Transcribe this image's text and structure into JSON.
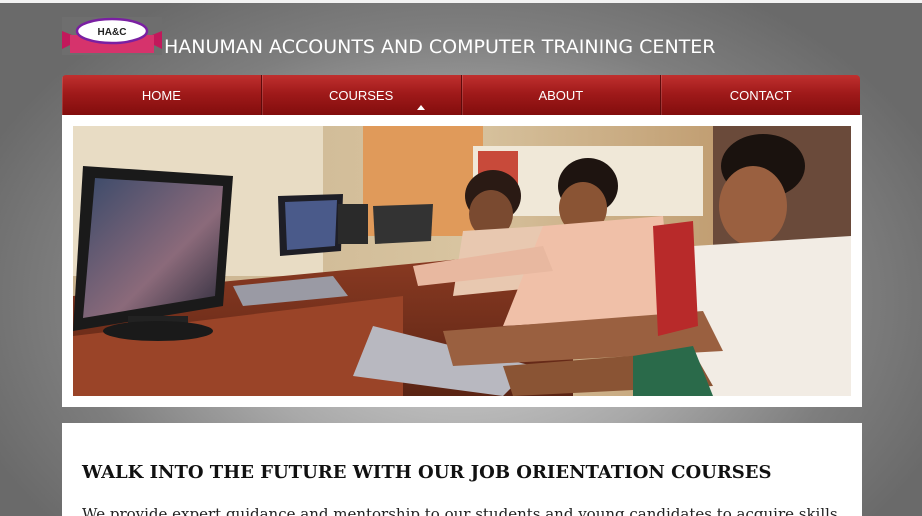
{
  "header": {
    "logo_text": "HA&C",
    "title": "HANUMAN ACCOUNTS AND COMPUTER TRAINING CENTER"
  },
  "nav": {
    "items": [
      {
        "label": "HOME"
      },
      {
        "label": "COURSES",
        "has_dropdown": true
      },
      {
        "label": "ABOUT"
      },
      {
        "label": "CONTACT"
      }
    ]
  },
  "main": {
    "heading": "WALK INTO THE FUTURE WITH OUR JOB ORIENTATION COURSES",
    "intro": "We provide expert guidance and mentorship to our students and young candidates to acquire skills"
  },
  "colors": {
    "nav_red": "#a01a1a",
    "logo_pink": "#d6336c",
    "logo_purple": "#7a1fa2"
  },
  "icons": {
    "dropdown": "caret-up-icon"
  }
}
